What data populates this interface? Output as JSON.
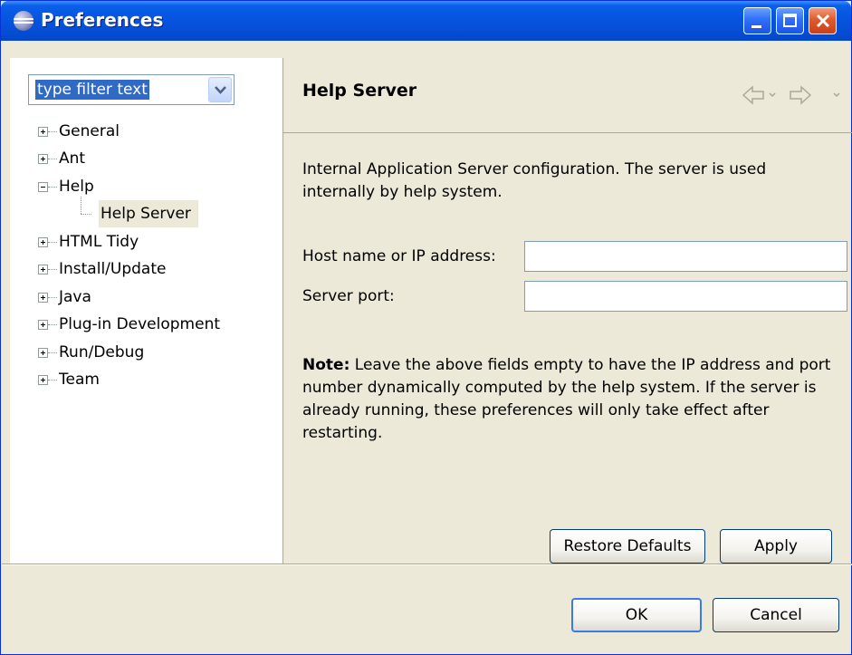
{
  "window": {
    "title": "Preferences"
  },
  "filter": {
    "value": "type filter text"
  },
  "tree": {
    "items": [
      {
        "label": "General",
        "expander": "plus"
      },
      {
        "label": "Ant",
        "expander": "plus"
      },
      {
        "label": "Help",
        "expander": "minus"
      },
      {
        "label": "Help Server",
        "expander": "none",
        "selected": true
      },
      {
        "label": "HTML Tidy",
        "expander": "plus"
      },
      {
        "label": "Install/Update",
        "expander": "plus"
      },
      {
        "label": "Java",
        "expander": "plus"
      },
      {
        "label": "Plug-in Development",
        "expander": "plus"
      },
      {
        "label": "Run/Debug",
        "expander": "plus"
      },
      {
        "label": "Team",
        "expander": "plus"
      }
    ]
  },
  "page": {
    "title": "Help Server",
    "description": "Internal Application Server configuration.  The server is used internally by help system.",
    "fields": {
      "host_label": "Host name or IP address:",
      "host_value": "",
      "port_label": "Server port:",
      "port_value": ""
    },
    "note_bold": "Note:",
    "note_text": " Leave the above fields empty to have the IP address and port number dynamically computed by the help system. If the server is already running, these preferences will only take effect after restarting."
  },
  "buttons": {
    "restore_defaults": "Restore Defaults",
    "apply": "Apply",
    "ok": "OK",
    "cancel": "Cancel"
  },
  "icons": {
    "title": "eclipse-icon",
    "back": "back-arrow-icon",
    "forward": "forward-arrow-icon"
  },
  "colors": {
    "titlebar": "#0654e0",
    "dialog_bg": "#ece9d8",
    "selection": "#316ac5"
  }
}
